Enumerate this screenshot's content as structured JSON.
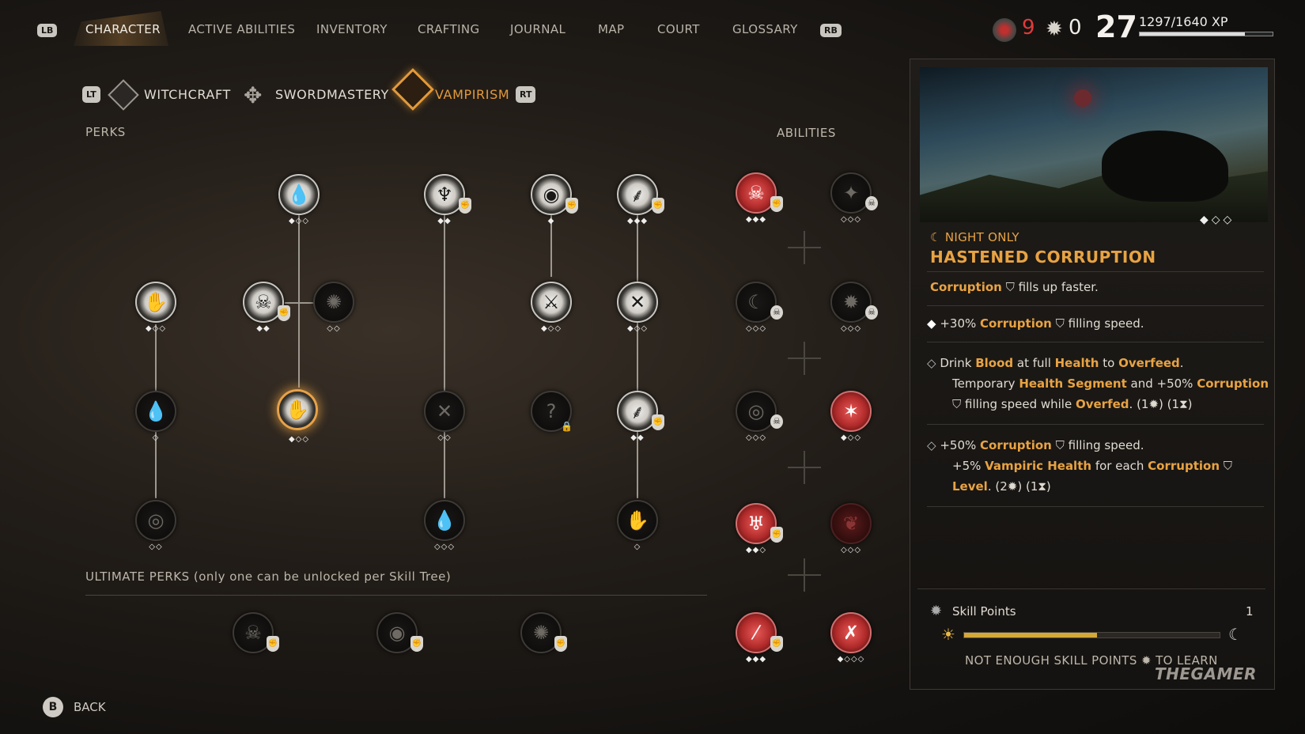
{
  "nav": {
    "lb": "LB",
    "rb": "RB",
    "tabs": [
      "CHARACTER",
      "ACTIVE ABILITIES",
      "INVENTORY",
      "CRAFTING",
      "JOURNAL",
      "MAP",
      "COURT",
      "GLOSSARY"
    ],
    "active_tab": "CHARACTER"
  },
  "stats": {
    "corruption_count": "9",
    "skill_points": "0",
    "level": "27",
    "xp": "1297/1640 XP",
    "xp_fraction": 0.79,
    "red_color": "#e03a3a"
  },
  "trees": {
    "lt": "LT",
    "rt": "RT",
    "items": [
      "WITCHCRAFT",
      "SWORDMASTERY",
      "VAMPIRISM"
    ],
    "active": "VAMPIRISM",
    "accent": "#e39a3a"
  },
  "sections": {
    "perks": "PERKS",
    "abilities": "ABILITIES",
    "ultimate": "ULTIMATE PERKS (only one can be unlocked per Skill Tree)"
  },
  "detail": {
    "tag": "NIGHT ONLY",
    "title": "HASTENED CORRUPTION",
    "summary": {
      "hl": "Corruption",
      "text": "fills up faster."
    },
    "tiers": [
      {
        "line1": [
          "+30% ",
          "Corruption",
          " filling speed."
        ]
      },
      {
        "line1": [
          "Drink ",
          "Blood",
          " at full ",
          "Health",
          " to ",
          "Overfeed",
          "."
        ],
        "line2": [
          "Temporary ",
          "Health Segment",
          " and +50% ",
          "Corruption"
        ],
        "line3": [
          "filling speed while ",
          "Overfed",
          ".",
          "  (1",
          ") (1",
          ")"
        ]
      },
      {
        "line1": [
          "+50% ",
          "Corruption",
          " filling speed."
        ],
        "line2": [
          "+5% ",
          "Vampiric Health",
          " for each ",
          "Corruption"
        ],
        "line3": [
          "Level",
          ".",
          "  (2",
          ") (1",
          ")"
        ]
      }
    ],
    "skill_points_label": "Skill Points",
    "skill_points_value": "1",
    "day_night_progress": 0.52,
    "not_enough": "NOT ENOUGH SKILL POINTS",
    "to_learn": "TO LEARN",
    "watermark": "THEGAMER",
    "accent": "#e8a343"
  },
  "footer": {
    "b": "B",
    "back": "BACK"
  }
}
